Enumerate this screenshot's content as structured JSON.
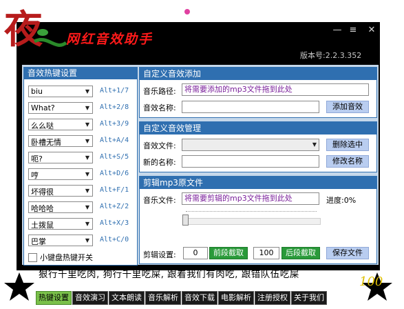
{
  "window": {
    "app_name": "网红音效助手",
    "version": "版本号:2.2.3.352",
    "minimize_glyph": "—",
    "menu_glyph": "≡",
    "close_glyph": "✕"
  },
  "hotkeys": {
    "title": "音效热键设置",
    "items": [
      {
        "sound": "biu",
        "key": "Alt+1/7"
      },
      {
        "sound": "What?",
        "key": "Alt+2/8"
      },
      {
        "sound": "么么哒",
        "key": "Alt+3/9"
      },
      {
        "sound": "卧槽无情",
        "key": "Alt+A/4"
      },
      {
        "sound": "呃?",
        "key": "Alt+S/5"
      },
      {
        "sound": "哼",
        "key": "Alt+D/6"
      },
      {
        "sound": "坏得很",
        "key": "Alt+F/1"
      },
      {
        "sound": "哈哈哈",
        "key": "Alt+Z/2"
      },
      {
        "sound": "土拨鼠",
        "key": "Alt+X/3"
      },
      {
        "sound": "巴掌",
        "key": "Alt+C/0"
      }
    ],
    "toggle_label": "小键盘热键开关"
  },
  "add_sound": {
    "title": "自定义音效添加",
    "path_label": "音乐路径:",
    "path_value": "将需要添加的mp3文件拖到此处",
    "name_label": "音效名称:",
    "name_value": "",
    "add_button": "添加音效"
  },
  "manage": {
    "title": "自定义音效管理",
    "file_label": "音效文件:",
    "file_value": "",
    "delete_button": "删除选中",
    "rename_label": "新的名称:",
    "rename_value": "",
    "rename_button": "修改名称"
  },
  "clip": {
    "title": "剪辑mp3原文件",
    "file_label": "音乐文件:",
    "file_value": "将需要剪辑的mp3文件拖到此处",
    "progress_label": "进度:0%",
    "progress": 0,
    "settings_label": "剪辑设置:",
    "start_value": "0",
    "start_button": "前段截取",
    "end_value": "100",
    "end_button": "后段截取",
    "save_button": "保存文件"
  },
  "marquee": "狠行千里吃肉, 狗行千里吃屎, 跟着我们有肉吃, 跟错队伍吃屎",
  "tabs": [
    {
      "label": "热键设置",
      "active": true
    },
    {
      "label": "音效演习",
      "active": false
    },
    {
      "label": "文本朗读",
      "active": false
    },
    {
      "label": "音乐解析",
      "active": false
    },
    {
      "label": "音效下载",
      "active": false
    },
    {
      "label": "电影解析",
      "active": false
    },
    {
      "label": "注册授权",
      "active": false
    },
    {
      "label": "关于我们",
      "active": false
    }
  ],
  "colors": {
    "panel_header": "#2f6fb0",
    "content_bg": "#c6d8ea",
    "window_bg": "#000000",
    "green_button": "#2a9a3a",
    "active_tab": "#7ac04a"
  }
}
